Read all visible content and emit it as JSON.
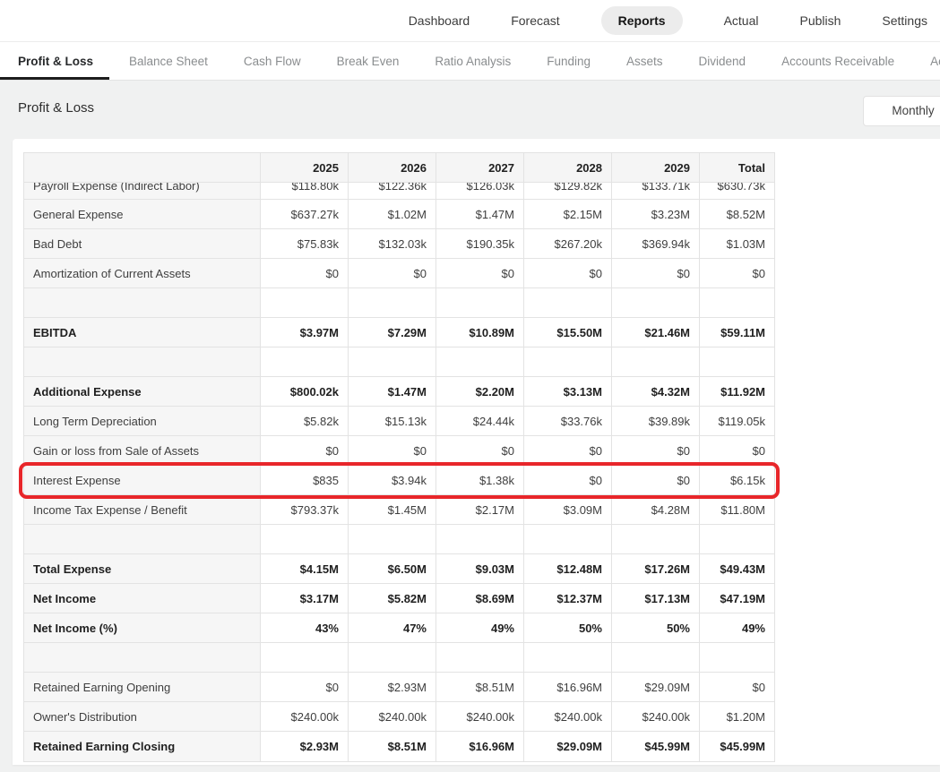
{
  "nav": {
    "items": [
      {
        "label": "Dashboard",
        "active": false
      },
      {
        "label": "Forecast",
        "active": false
      },
      {
        "label": "Reports",
        "active": true
      },
      {
        "label": "Actual",
        "active": false
      },
      {
        "label": "Publish",
        "active": false
      },
      {
        "label": "Settings",
        "active": false
      }
    ]
  },
  "tabs": {
    "items": [
      {
        "label": "Profit & Loss",
        "active": true
      },
      {
        "label": "Balance Sheet",
        "active": false
      },
      {
        "label": "Cash Flow",
        "active": false
      },
      {
        "label": "Break Even",
        "active": false
      },
      {
        "label": "Ratio Analysis",
        "active": false
      },
      {
        "label": "Funding",
        "active": false
      },
      {
        "label": "Assets",
        "active": false
      },
      {
        "label": "Dividend",
        "active": false
      },
      {
        "label": "Accounts Receivable",
        "active": false
      },
      {
        "label": "Accounts",
        "truncated": true,
        "active": false
      }
    ]
  },
  "page": {
    "title": "Profit & Loss",
    "period_selector_label": "Monthly"
  },
  "table": {
    "columns": [
      "",
      "2025",
      "2026",
      "2027",
      "2028",
      "2029",
      "Total"
    ],
    "highlight_color": "#e8262a",
    "highlighted_row": "Interest Expense",
    "rows": [
      {
        "label": "Payroll Expense (Indirect Labor)",
        "values": [
          "$118.80k",
          "$122.36k",
          "$126.03k",
          "$129.82k",
          "$133.71k",
          "$630.73k"
        ],
        "clipped": true
      },
      {
        "label": "General Expense",
        "values": [
          "$637.27k",
          "$1.02M",
          "$1.47M",
          "$2.15M",
          "$3.23M",
          "$8.52M"
        ]
      },
      {
        "label": "Bad Debt",
        "values": [
          "$75.83k",
          "$132.03k",
          "$190.35k",
          "$267.20k",
          "$369.94k",
          "$1.03M"
        ]
      },
      {
        "label": "Amortization of Current Assets",
        "values": [
          "$0",
          "$0",
          "$0",
          "$0",
          "$0",
          "$0"
        ]
      },
      {
        "label": "",
        "values": [
          "",
          "",
          "",
          "",
          "",
          ""
        ],
        "empty": true
      },
      {
        "label": "EBITDA",
        "values": [
          "$3.97M",
          "$7.29M",
          "$10.89M",
          "$15.50M",
          "$21.46M",
          "$59.11M"
        ],
        "bold": true
      },
      {
        "label": "",
        "values": [
          "",
          "",
          "",
          "",
          "",
          ""
        ],
        "empty": true
      },
      {
        "label": "Additional Expense",
        "values": [
          "$800.02k",
          "$1.47M",
          "$2.20M",
          "$3.13M",
          "$4.32M",
          "$11.92M"
        ],
        "bold": true
      },
      {
        "label": "Long Term Depreciation",
        "values": [
          "$5.82k",
          "$15.13k",
          "$24.44k",
          "$33.76k",
          "$39.89k",
          "$119.05k"
        ]
      },
      {
        "label": "Gain or loss from Sale of Assets",
        "values": [
          "$0",
          "$0",
          "$0",
          "$0",
          "$0",
          "$0"
        ]
      },
      {
        "label": "Interest Expense",
        "values": [
          "$835",
          "$3.94k",
          "$1.38k",
          "$0",
          "$0",
          "$6.15k"
        ],
        "highlighted": true
      },
      {
        "label": "Income Tax Expense / Benefit",
        "values": [
          "$793.37k",
          "$1.45M",
          "$2.17M",
          "$3.09M",
          "$4.28M",
          "$11.80M"
        ]
      },
      {
        "label": "",
        "values": [
          "",
          "",
          "",
          "",
          "",
          ""
        ],
        "empty": true
      },
      {
        "label": "Total Expense",
        "values": [
          "$4.15M",
          "$6.50M",
          "$9.03M",
          "$12.48M",
          "$17.26M",
          "$49.43M"
        ],
        "bold": true
      },
      {
        "label": "Net Income",
        "values": [
          "$3.17M",
          "$5.82M",
          "$8.69M",
          "$12.37M",
          "$17.13M",
          "$47.19M"
        ],
        "bold": true
      },
      {
        "label": "Net Income (%)",
        "values": [
          "43%",
          "47%",
          "49%",
          "50%",
          "50%",
          "49%"
        ],
        "bold": true
      },
      {
        "label": "",
        "values": [
          "",
          "",
          "",
          "",
          "",
          ""
        ],
        "empty": true
      },
      {
        "label": "Retained Earning Opening",
        "values": [
          "$0",
          "$2.93M",
          "$8.51M",
          "$16.96M",
          "$29.09M",
          "$0"
        ]
      },
      {
        "label": "Owner's Distribution",
        "values": [
          "$240.00k",
          "$240.00k",
          "$240.00k",
          "$240.00k",
          "$240.00k",
          "$1.20M"
        ]
      },
      {
        "label": "Retained Earning Closing",
        "values": [
          "$2.93M",
          "$8.51M",
          "$16.96M",
          "$29.09M",
          "$45.99M",
          "$45.99M"
        ],
        "bold": true
      }
    ]
  }
}
